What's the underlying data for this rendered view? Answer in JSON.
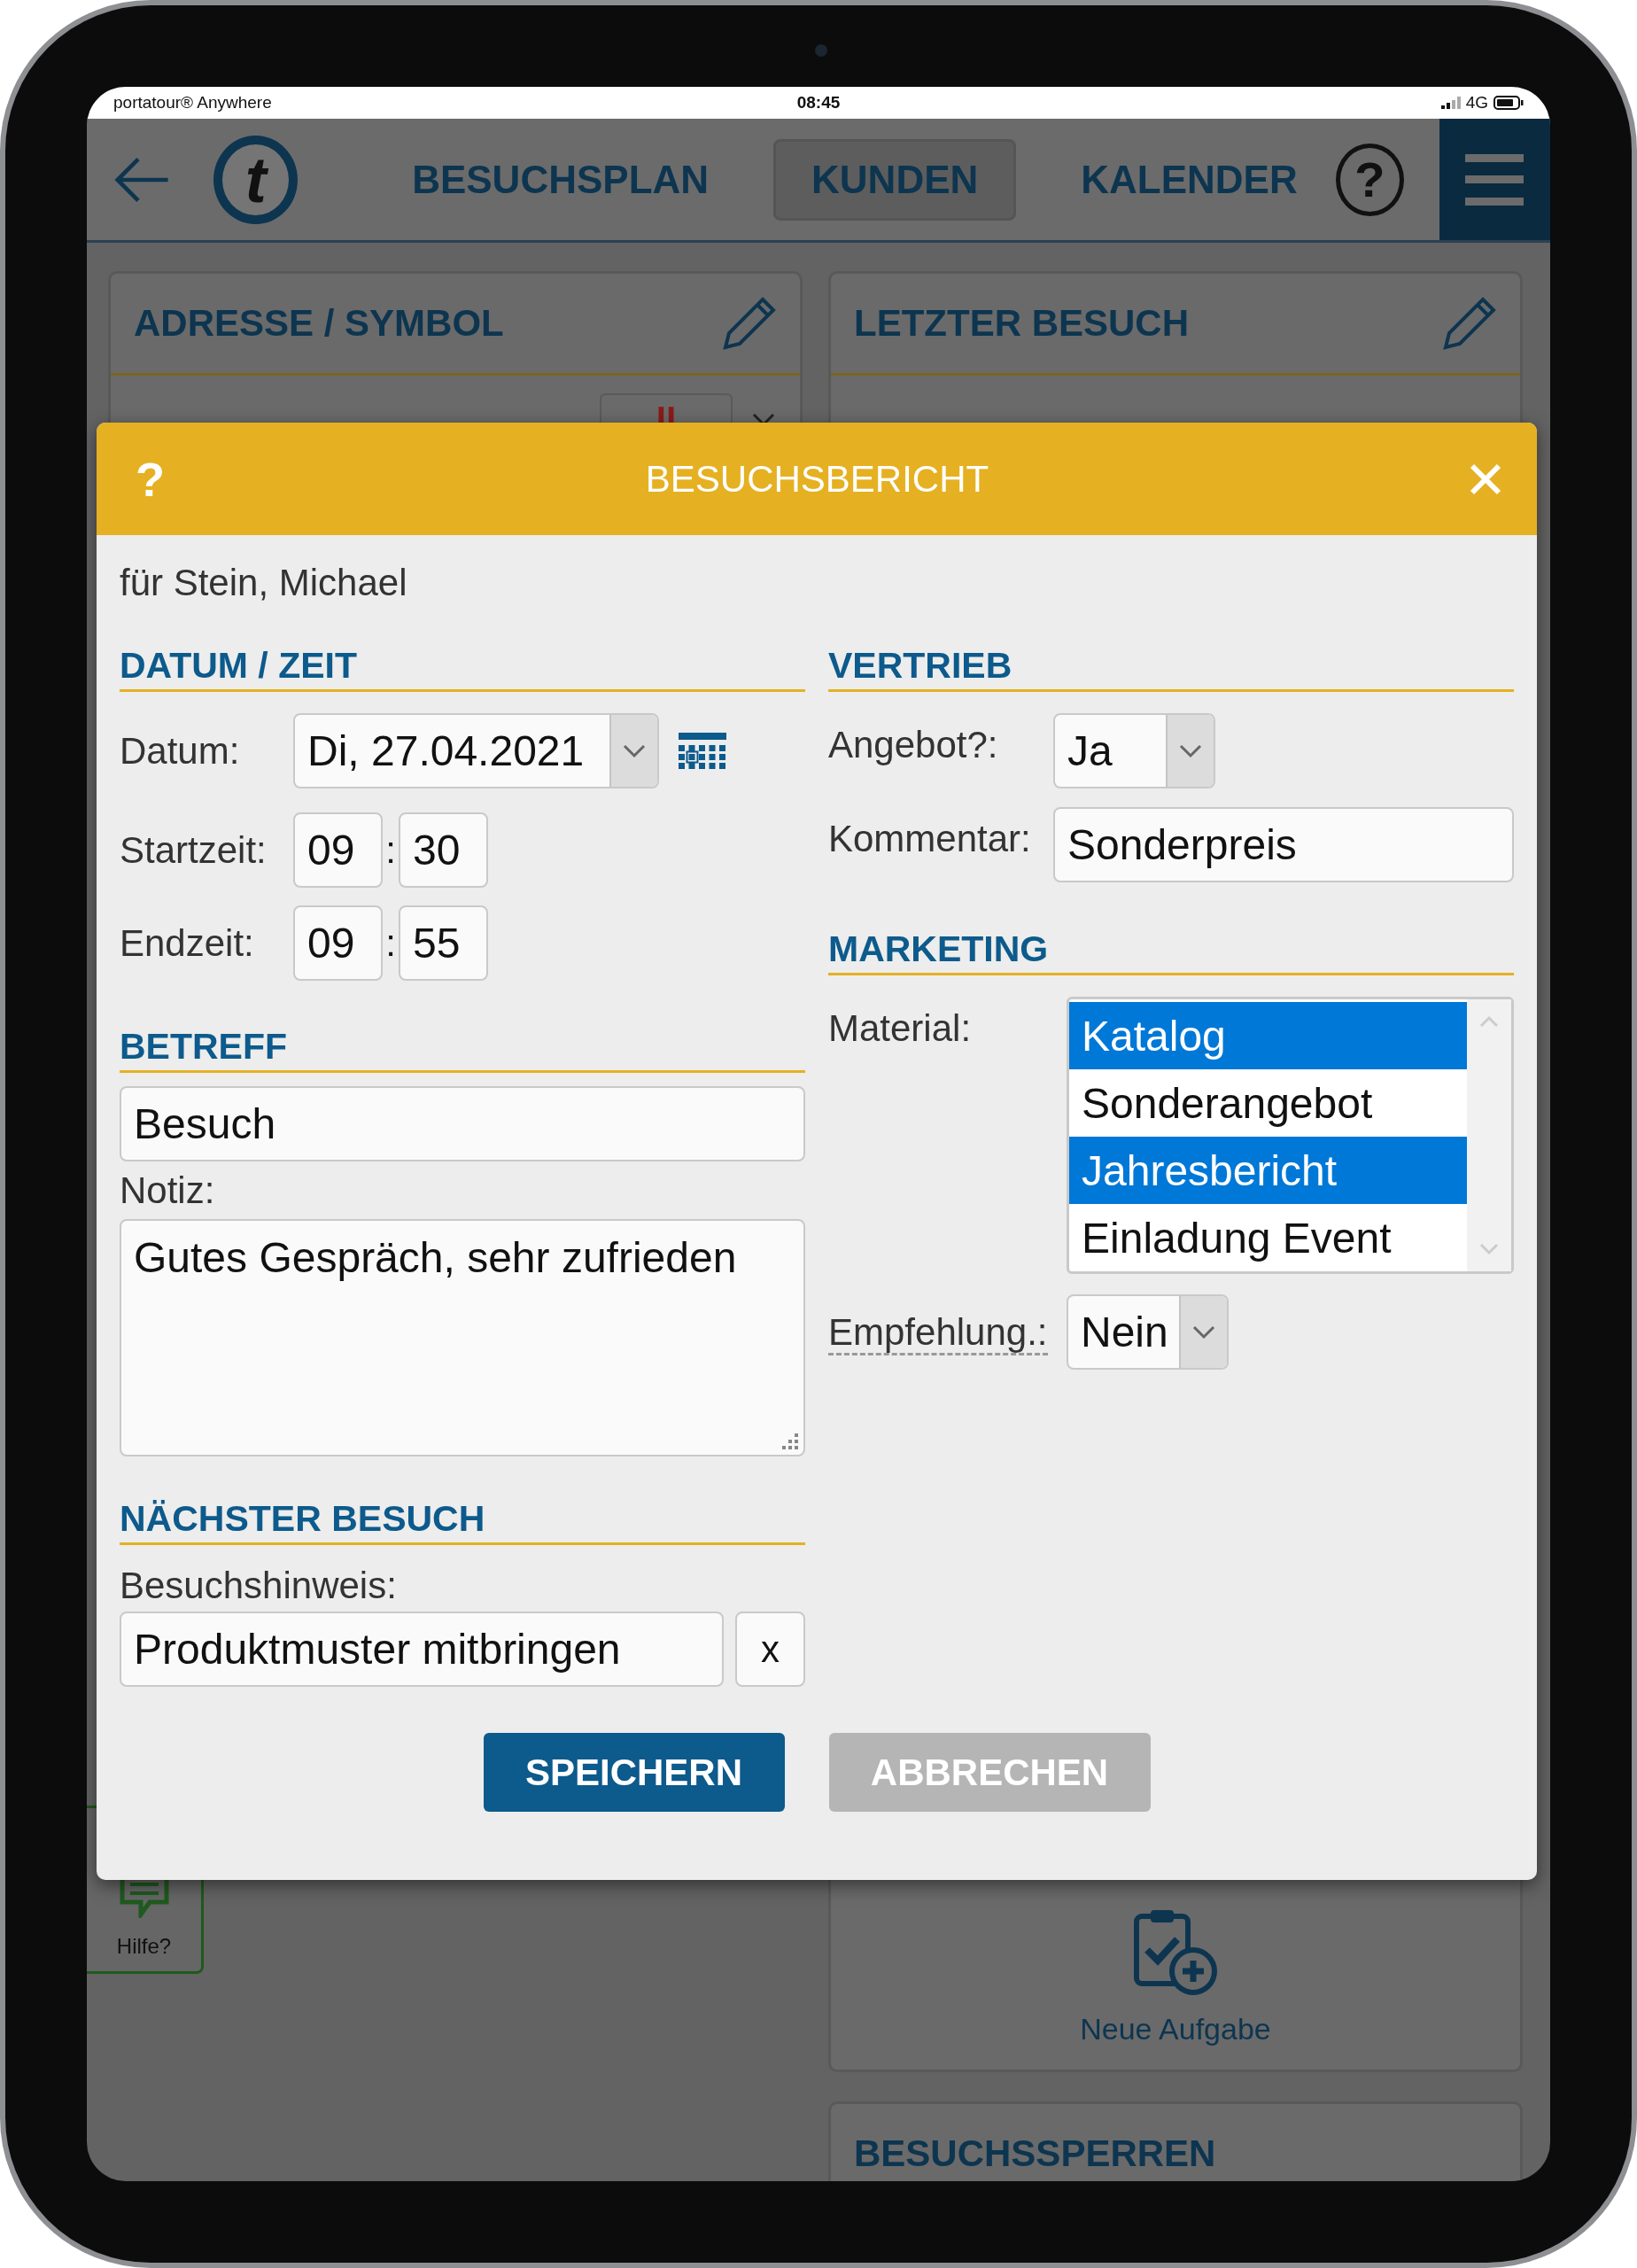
{
  "status_bar": {
    "app": "portatour® Anywhere",
    "time": "08:45",
    "network": "4G"
  },
  "nav": {
    "logo_letter": "t",
    "tabs": [
      {
        "label": "BESUCHSPLAN",
        "selected": false
      },
      {
        "label": "KUNDEN",
        "selected": true
      },
      {
        "label": "KALENDER",
        "selected": false
      }
    ],
    "help": "?"
  },
  "cards": [
    {
      "title": "ADRESSE / SYMBOL"
    },
    {
      "title": "LETZTER BESUCH"
    }
  ],
  "new_task": {
    "label": "Neue Aufgabe"
  },
  "blocked_card": {
    "title": "BESUCHSSPERREN"
  },
  "help_tab": {
    "label": "Hilfe?"
  },
  "dialog": {
    "help": "?",
    "title": "BESUCHSBERICHT",
    "subtitle": "für Stein, Michael",
    "datetime": {
      "heading": "DATUM / ZEIT",
      "date_label": "Datum:",
      "date": "Di, 27.04.2021",
      "times": [
        {
          "label": "Startzeit:",
          "hour": "09",
          "separator": ":",
          "minute": "30"
        },
        {
          "label": "Endzeit:",
          "hour": "09",
          "separator": ":",
          "minute": "55"
        }
      ]
    },
    "subject": {
      "heading": "BETREFF",
      "value": "Besuch",
      "note_label": "Notiz:",
      "note": "Gutes Gespräch, sehr zufrieden"
    },
    "next_visit": {
      "heading": "NÄCHSTER BESUCH",
      "hint_label": "Besuchshinweis:",
      "hint_field": {
        "value": "Produktmuster mitbringen"
      },
      "clear": "x"
    },
    "sales": {
      "heading": "VERTRIEB",
      "offer_label": "Angebot?:",
      "offer": "Ja",
      "comment_label": "Kommentar:",
      "comment": "Sonderpreis"
    },
    "marketing": {
      "heading": "MARKETING",
      "material_label": "Material:",
      "materials": [
        {
          "label": "Katalog",
          "selected": true
        },
        {
          "label": "Sonderangebot",
          "selected": false
        },
        {
          "label": "Jahresbericht",
          "selected": true
        },
        {
          "label": "Einladung Event",
          "selected": false
        }
      ],
      "referral_label": "Empfehlung.:",
      "referral": "Nein"
    },
    "buttons": [
      {
        "label": "SPEICHERN",
        "kind": "primary"
      },
      {
        "label": "ABBRECHEN",
        "kind": "secondary"
      }
    ]
  }
}
